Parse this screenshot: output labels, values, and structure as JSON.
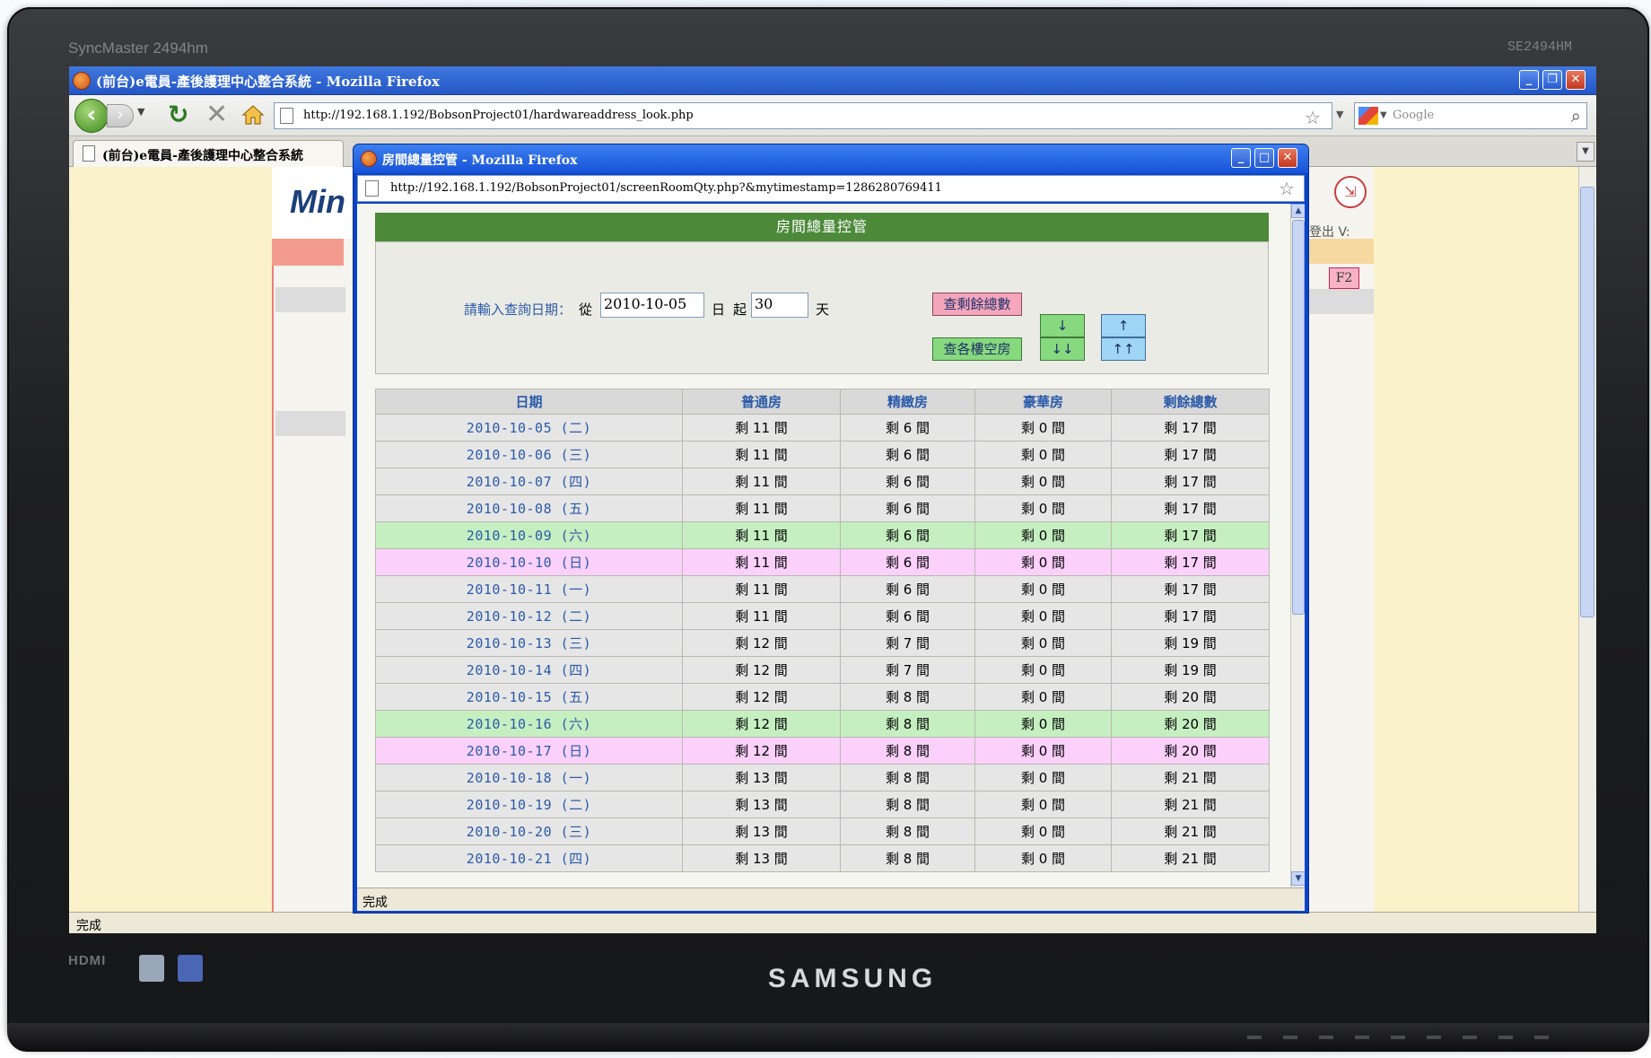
{
  "monitor": {
    "model": "SyncMaster 2494hm",
    "code": "SE2494HM",
    "hdmi": "HDMI",
    "brand": "SAMSUNG"
  },
  "browser": {
    "title": "(前台)e電員-產後護理中心整合系統 - Mozilla Firefox",
    "url": "http://192.168.1.192/BobsonProject01/hardwareaddress_look.php",
    "search_placeholder": "Google",
    "tab_label": "(前台)e電員-產後護理中心整合系統",
    "status": "完成",
    "bg_page": {
      "logo": "Min",
      "logout_text": "登出  V:",
      "f2": "F2"
    }
  },
  "popup": {
    "title": "房間總量控管 - Mozilla Firefox",
    "url": "http://192.168.1.192/BobsonProject01/screenRoomQty.php?&mytimestamp=1286280769411",
    "status": "完成",
    "header": "房間總量控管",
    "query": {
      "label": "請輸入查詢日期：",
      "from": "從",
      "date": "2010-10-05",
      "day_unit": "日",
      "start": "起",
      "days": "30",
      "days_unit": "天",
      "btn_remaining": "查剩餘總數",
      "btn_buildings": "查各樓空房",
      "btn_down": "↓",
      "btn_down_all": "↓↓",
      "btn_up": "↑",
      "btn_up_all": "↑↑"
    },
    "columns": [
      "日期",
      "普通房",
      "精緻房",
      "豪華房",
      "剩餘總數"
    ],
    "rows": [
      {
        "date": "2010-10-05 (二)",
        "normal": "剩 11 間",
        "deluxe": "剩 6 間",
        "luxury": "剩 0 間",
        "total": "剩 17 間",
        "kind": "weekday"
      },
      {
        "date": "2010-10-06 (三)",
        "normal": "剩 11 間",
        "deluxe": "剩 6 間",
        "luxury": "剩 0 間",
        "total": "剩 17 間",
        "kind": "weekday"
      },
      {
        "date": "2010-10-07 (四)",
        "normal": "剩 11 間",
        "deluxe": "剩 6 間",
        "luxury": "剩 0 間",
        "total": "剩 17 間",
        "kind": "weekday"
      },
      {
        "date": "2010-10-08 (五)",
        "normal": "剩 11 間",
        "deluxe": "剩 6 間",
        "luxury": "剩 0 間",
        "total": "剩 17 間",
        "kind": "weekday"
      },
      {
        "date": "2010-10-09 (六)",
        "normal": "剩 11 間",
        "deluxe": "剩 6 間",
        "luxury": "剩 0 間",
        "total": "剩 17 間",
        "kind": "sat"
      },
      {
        "date": "2010-10-10 (日)",
        "normal": "剩 11 間",
        "deluxe": "剩 6 間",
        "luxury": "剩 0 間",
        "total": "剩 17 間",
        "kind": "sun"
      },
      {
        "date": "2010-10-11 (一)",
        "normal": "剩 11 間",
        "deluxe": "剩 6 間",
        "luxury": "剩 0 間",
        "total": "剩 17 間",
        "kind": "weekday"
      },
      {
        "date": "2010-10-12 (二)",
        "normal": "剩 11 間",
        "deluxe": "剩 6 間",
        "luxury": "剩 0 間",
        "total": "剩 17 間",
        "kind": "weekday"
      },
      {
        "date": "2010-10-13 (三)",
        "normal": "剩 12 間",
        "deluxe": "剩 7 間",
        "luxury": "剩 0 間",
        "total": "剩 19 間",
        "kind": "weekday"
      },
      {
        "date": "2010-10-14 (四)",
        "normal": "剩 12 間",
        "deluxe": "剩 7 間",
        "luxury": "剩 0 間",
        "total": "剩 19 間",
        "kind": "weekday"
      },
      {
        "date": "2010-10-15 (五)",
        "normal": "剩 12 間",
        "deluxe": "剩 8 間",
        "luxury": "剩 0 間",
        "total": "剩 20 間",
        "kind": "weekday"
      },
      {
        "date": "2010-10-16 (六)",
        "normal": "剩 12 間",
        "deluxe": "剩 8 間",
        "luxury": "剩 0 間",
        "total": "剩 20 間",
        "kind": "sat"
      },
      {
        "date": "2010-10-17 (日)",
        "normal": "剩 12 間",
        "deluxe": "剩 8 間",
        "luxury": "剩 0 間",
        "total": "剩 20 間",
        "kind": "sun"
      },
      {
        "date": "2010-10-18 (一)",
        "normal": "剩 13 間",
        "deluxe": "剩 8 間",
        "luxury": "剩 0 間",
        "total": "剩 21 間",
        "kind": "weekday"
      },
      {
        "date": "2010-10-19 (二)",
        "normal": "剩 13 間",
        "deluxe": "剩 8 間",
        "luxury": "剩 0 間",
        "total": "剩 21 間",
        "kind": "weekday"
      },
      {
        "date": "2010-10-20 (三)",
        "normal": "剩 13 間",
        "deluxe": "剩 8 間",
        "luxury": "剩 0 間",
        "total": "剩 21 間",
        "kind": "weekday"
      },
      {
        "date": "2010-10-21 (四)",
        "normal": "剩 13 間",
        "deluxe": "剩 8 間",
        "luxury": "剩 0 間",
        "total": "剩 21 間",
        "kind": "weekday"
      }
    ]
  }
}
